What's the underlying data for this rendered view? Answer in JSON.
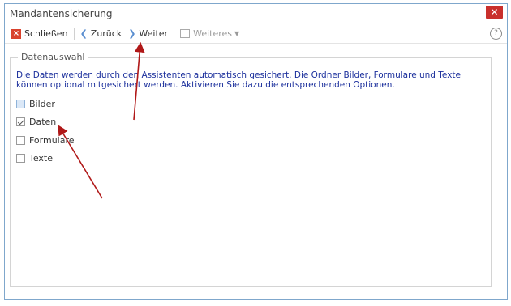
{
  "window": {
    "title": "Mandantensicherung",
    "close_glyph": "✕"
  },
  "toolbar": {
    "close_label": "Schließen",
    "back_label": "Zurück",
    "next_label": "Weiter",
    "more_label": "Weiteres",
    "help_glyph": "?"
  },
  "group": {
    "title": "Datenauswahl",
    "description": "Die Daten werden durch den Assistenten automatisch gesichert. Die Ordner Bilder, Formulare und Texte können optional mitgesichert werden. Aktivieren Sie dazu die entsprechenden Optionen."
  },
  "options": [
    {
      "label": "Bilder",
      "checked": false,
      "highlighted": true
    },
    {
      "label": "Daten",
      "checked": true,
      "highlighted": false
    },
    {
      "label": "Formulare",
      "checked": false,
      "highlighted": false
    },
    {
      "label": "Texte",
      "checked": false,
      "highlighted": false
    }
  ],
  "colors": {
    "accent": "#c9302c",
    "description_text": "#1b2f9c",
    "annotation_arrow": "#b01818"
  }
}
